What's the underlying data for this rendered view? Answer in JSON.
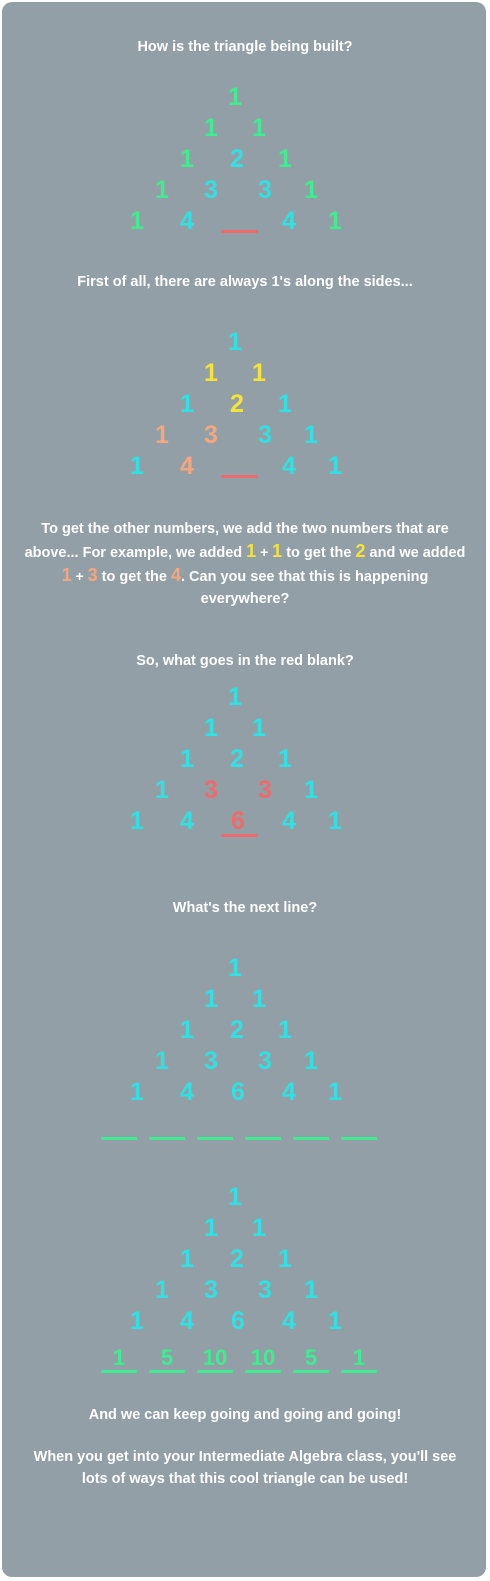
{
  "colors": {
    "background": "#939fa6",
    "text": "#ffffff",
    "cyan": "#31e0e2",
    "green": "#3fec8f",
    "yellow": "#f6e33a",
    "orange": "#f3a77f",
    "red": "#ef6b6b"
  },
  "texts": {
    "q1": "How is the triangle being built?",
    "sides": "First of all, there are always 1's along the sides...",
    "explain_a": "To get the other numbers, we add the two numbers that are above... For example, we added ",
    "one_a": "1",
    "plus_a": " + ",
    "one_b": "1",
    "explain_b": " to get the ",
    "two": "2",
    "explain_c": " and we added ",
    "one_c": "1",
    "plus_b": " + ",
    "three": "3",
    "explain_d": " to get the ",
    "four": "4",
    "explain_e": ". Can you see that this is happening everywhere?",
    "q2": "So, what goes in the red blank?",
    "q3": "What's the next line?",
    "keep": "And we can keep going and going and going!",
    "algebra": "When you get into your Intermediate Algebra class, you'll see lots of ways that this cool triangle can be used!"
  },
  "triangles": {
    "t1": [
      "1",
      "1",
      "1",
      "1",
      "2",
      "1",
      "1",
      "3",
      "3",
      "1",
      "1",
      "4",
      "4",
      "1"
    ],
    "t2": [
      "1",
      "1",
      "1",
      "1",
      "2",
      "1",
      "1",
      "3",
      "3",
      "1",
      "1",
      "4",
      "4",
      "1"
    ],
    "t3": [
      "1",
      "1",
      "1",
      "1",
      "2",
      "1",
      "1",
      "3",
      "3",
      "1",
      "1",
      "4",
      "6",
      "4",
      "1"
    ],
    "t4": [
      "1",
      "1",
      "1",
      "1",
      "2",
      "1",
      "1",
      "3",
      "3",
      "1",
      "1",
      "4",
      "6",
      "4",
      "1"
    ],
    "t5": [
      "1",
      "1",
      "1",
      "1",
      "2",
      "1",
      "1",
      "3",
      "3",
      "1",
      "1",
      "4",
      "6",
      "4",
      "1"
    ],
    "t5_row6": [
      "1",
      "5",
      "10",
      "10",
      "5",
      "1"
    ]
  }
}
